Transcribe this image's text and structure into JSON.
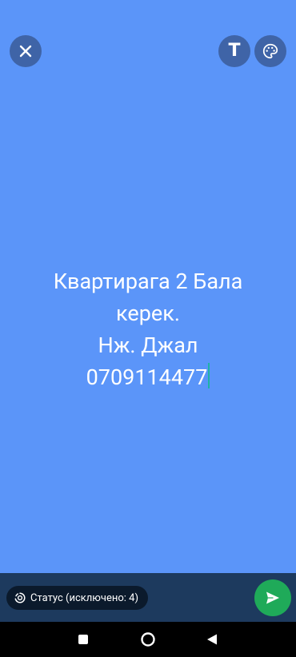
{
  "colors": {
    "canvas_background": "#5B95F9",
    "bottom_bar": "#1D3A5E",
    "send_button": "#1FAA59",
    "cursor": "#1FB2A6"
  },
  "toolbar": {
    "close_icon": "close-icon",
    "text_button_label": "T",
    "palette_icon": "palette-icon"
  },
  "status": {
    "lines": [
      "Квартирага 2 Бала",
      "керек.",
      "Нж. Джал",
      "0709114477"
    ]
  },
  "composer": {
    "audience_label": "Статус (исключено: 4)",
    "audience_icon": "status-ring-icon",
    "send_icon": "send-icon"
  },
  "navigation": {
    "recents_icon": "square-icon",
    "home_icon": "circle-icon",
    "back_icon": "triangle-back-icon"
  }
}
